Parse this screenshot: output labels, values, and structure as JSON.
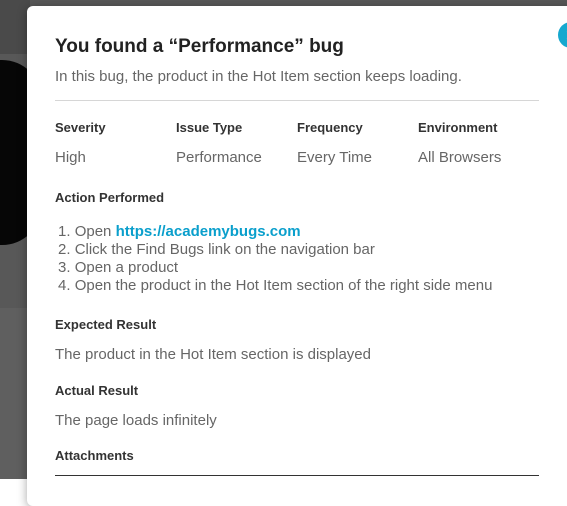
{
  "modal": {
    "close_icon": "×",
    "title": "You found a “Performance” bug",
    "subtitle": "In this bug, the product in the Hot Item section keeps loading.",
    "properties": [
      {
        "label": "Severity",
        "value": "High"
      },
      {
        "label": "Issue Type",
        "value": "Performance"
      },
      {
        "label": "Frequency",
        "value": "Every Time"
      },
      {
        "label": "Environment",
        "value": "All Browsers"
      }
    ],
    "action": {
      "title": "Action Performed",
      "steps": [
        {
          "number": "1.",
          "text": "Open",
          "link": "https://academybugs.com"
        },
        {
          "number": "2.",
          "text": "Click the Find Bugs link on the navigation bar"
        },
        {
          "number": "3.",
          "text": "Open a product"
        },
        {
          "number": "4.",
          "text": "Open the product in the Hot Item section of the right side menu"
        }
      ]
    },
    "expected": {
      "title": "Expected Result",
      "text": "The product in the Hot Item section is displayed"
    },
    "actual": {
      "title": "Actual Result",
      "text": "The page loads infinitely"
    },
    "attachments": {
      "title": "Attachments"
    }
  },
  "colors": {
    "accent": "#16a8cf",
    "link": "#0a9fcc",
    "backdrop": "#585858"
  },
  "icons": {
    "close": "close-icon"
  }
}
